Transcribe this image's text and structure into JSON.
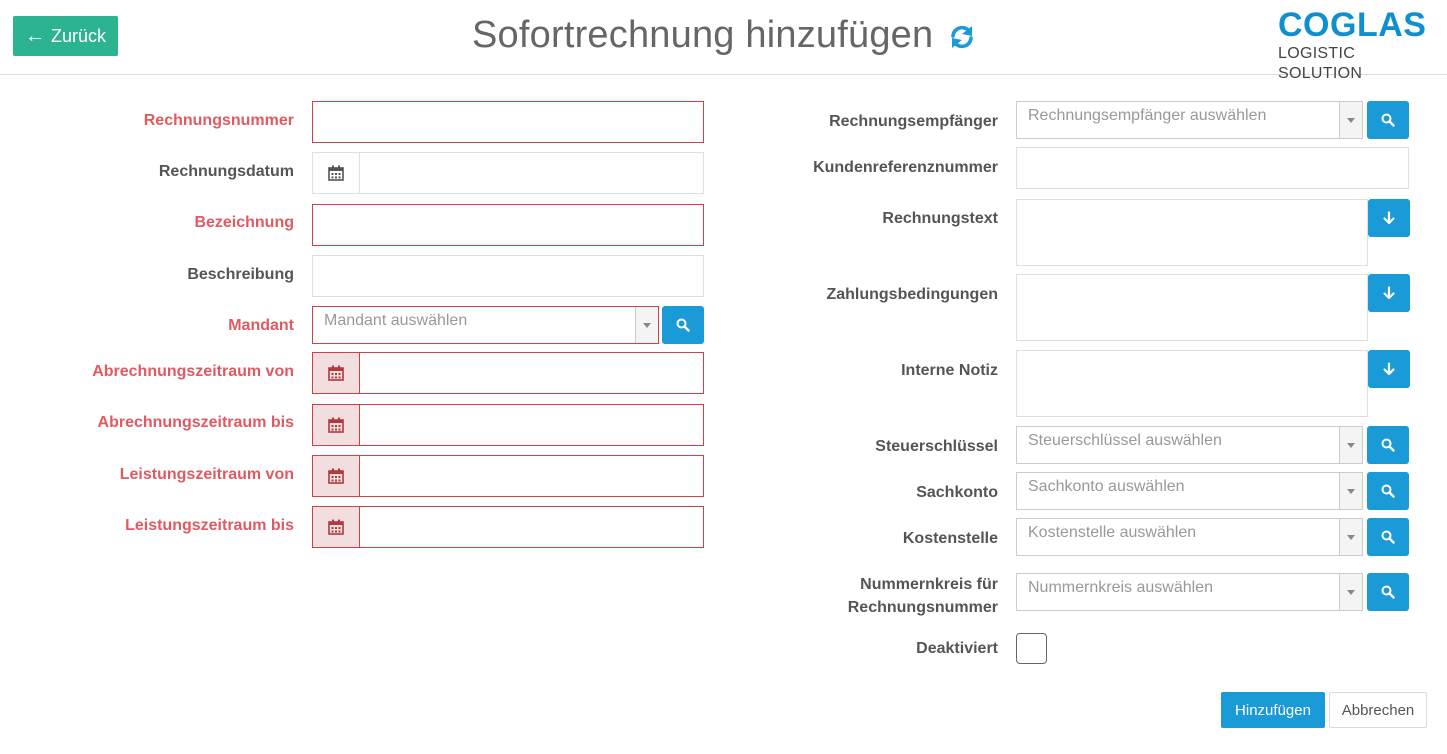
{
  "header": {
    "back_label": "Zurück",
    "title": "Sofortrechnung hinzufügen",
    "logo_main": "COGLAS",
    "logo_sub": "LOGISTIC SOLUTION"
  },
  "left_form": {
    "rechnungsnummer": "Rechnungsnummer",
    "rechnungsdatum": "Rechnungsdatum",
    "bezeichnung": "Bezeichnung",
    "beschreibung": "Beschreibung",
    "mandant": "Mandant",
    "mandant_placeholder": "Mandant auswählen",
    "abrechnung_von": "Abrechnungszeitraum von",
    "abrechnung_bis": "Abrechnungszeitraum bis",
    "leistung_von": "Leistungszeitraum von",
    "leistung_bis": "Leistungszeitraum bis"
  },
  "right_form": {
    "empfaenger": "Rechnungsempfänger",
    "empfaenger_placeholder": "Rechnungsempfänger auswählen",
    "kundenreferenz": "Kundenreferenznummer",
    "rechnungstext": "Rechnungstext",
    "zahlungsbedingungen": "Zahlungsbedingungen",
    "interne_notiz": "Interne Notiz",
    "steuerschluessel": "Steuerschlüssel",
    "steuerschluessel_placeholder": "Steuerschlüssel auswählen",
    "sachkonto": "Sachkonto",
    "sachkonto_placeholder": "Sachkonto auswählen",
    "kostenstelle": "Kostenstelle",
    "kostenstelle_placeholder": "Kostenstelle auswählen",
    "nummernkreis_line1": "Nummernkreis für",
    "nummernkreis_line2": "Rechnungsnummer",
    "nummernkreis_placeholder": "Nummernkreis auswählen",
    "deaktiviert": "Deaktiviert"
  },
  "actions": {
    "add_label": "Hinzufügen",
    "cancel_label": "Abbrechen"
  },
  "colors": {
    "primary": "#1a9ad6",
    "back_button": "#2cb38f",
    "required": "#e05a62",
    "required_border": "#d04047",
    "logo": "#0f8fcf"
  },
  "icons": {
    "back": "arrow-left-icon",
    "refresh": "refresh-icon",
    "calendar": "calendar-icon",
    "search": "search-icon",
    "insert": "arrow-down-icon"
  }
}
